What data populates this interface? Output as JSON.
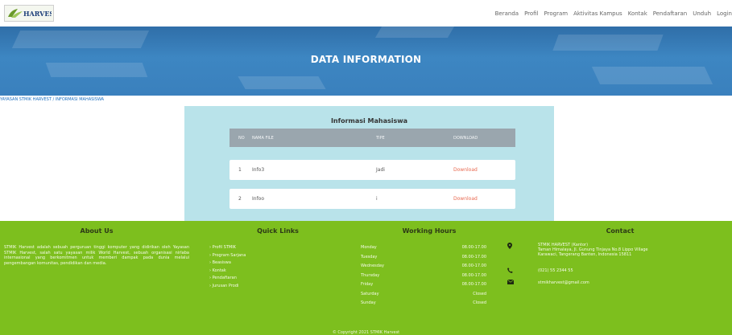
{
  "brand": {
    "logo_text": "HARVEST"
  },
  "nav": [
    "Beranda",
    "Profil",
    "Program",
    "Aktivitas Kampus",
    "Kontak",
    "Pendaftaran",
    "Unduh",
    "Login"
  ],
  "hero": {
    "title": "DATA INFORMATION"
  },
  "breadcrumb": "YAYASAN STMIK HARVEST / INFORMASI MAHASISWA",
  "main": {
    "title": "Informasi Mahasiswa",
    "columns": [
      "NO",
      "NAMA FILE",
      "TIPE",
      "DOWNLOAD"
    ],
    "rows": [
      {
        "no": "1",
        "name": "Info3",
        "type": "Jadi",
        "download": "Download"
      },
      {
        "no": "2",
        "name": "Infoo",
        "type": "i",
        "download": "Download"
      }
    ]
  },
  "footer": {
    "about_title": "About Us",
    "about_text": "STMIK Harvest adalah sebuah perguruan tinggi komputer yang didirikan oleh Yayasan STMIK Harvest, salah satu yayasan milik World Harvest, sebuah organisasi nirlaba internasional yang berkomitmen untuk memberi dampak pada dunia melalui pengembangan komunitas, pendidikan dan media.",
    "links_title": "Quick Links",
    "links": [
      "Profil STMIK",
      "Program Sarjana",
      "Beasiswa",
      "Kontak",
      "Pendaftaran",
      "Jurusan Prodi"
    ],
    "hours_title": "Working Hours",
    "hours": [
      {
        "day": "Monday",
        "time": "08.00-17.00"
      },
      {
        "day": "Tuesday",
        "time": "08.00-17.00"
      },
      {
        "day": "Wednesday",
        "time": "08.00-17.00"
      },
      {
        "day": "Thursday",
        "time": "08.00-17.00"
      },
      {
        "day": "Friday",
        "time": "08.00-17.00"
      },
      {
        "day": "Saturday",
        "time": "Closed"
      },
      {
        "day": "Sunday",
        "time": "Closed"
      }
    ],
    "contact_title": "Contact",
    "contact_address_1": "STMIK HARVEST (Kantor)",
    "contact_address_2": "Taman Himalaya, Jl. Gunung Tinjaya No.8 Lippo Village",
    "contact_address_3": "Karawaci, Tangerang Banten, Indonesia 15811",
    "contact_phone": "(021) 55 2344 55",
    "contact_email": "stmikharvest@gmail.com",
    "copyright": "© Copyright 2021 STMIK Harvest"
  },
  "colors": {
    "hero": "#3a80bd",
    "panel": "#b9e3ea",
    "table_header": "#9aa6ae",
    "download_link": "#e8684f",
    "footer": "#7dbf1e"
  }
}
